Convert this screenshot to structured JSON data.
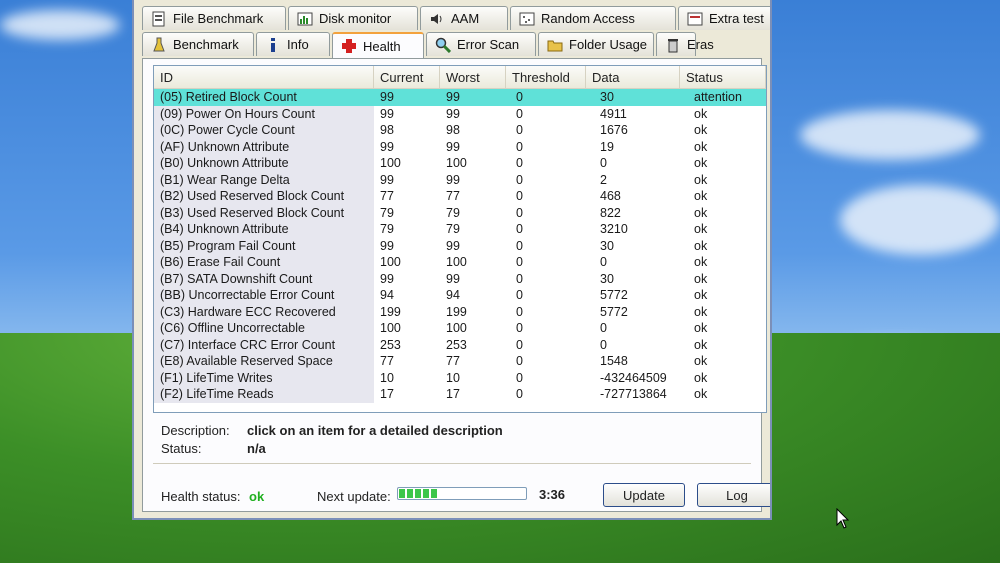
{
  "tabs_row1": [
    {
      "label": "File Benchmark",
      "icon": "file-benchmark-icon"
    },
    {
      "label": "Disk monitor",
      "icon": "disk-monitor-icon"
    },
    {
      "label": "AAM",
      "icon": "speaker-icon"
    },
    {
      "label": "Random Access",
      "icon": "random-access-icon"
    },
    {
      "label": "Extra test",
      "icon": "extra-tests-icon"
    }
  ],
  "tabs_row2": [
    {
      "label": "Benchmark",
      "icon": "benchmark-icon"
    },
    {
      "label": "Info",
      "icon": "info-icon"
    },
    {
      "label": "Health",
      "icon": "health-cross-icon",
      "active": true
    },
    {
      "label": "Error Scan",
      "icon": "magnifier-icon"
    },
    {
      "label": "Folder Usage",
      "icon": "folder-icon"
    },
    {
      "label": "Eras",
      "icon": "trash-icon"
    }
  ],
  "columns": [
    "ID",
    "Current",
    "Worst",
    "Threshold",
    "Data",
    "Status"
  ],
  "rows": [
    {
      "id": "(05) Retired Block Count",
      "cur": "99",
      "worst": "99",
      "thr": "0",
      "data": "30",
      "status": "attention"
    },
    {
      "id": "(09) Power On Hours Count",
      "cur": "99",
      "worst": "99",
      "thr": "0",
      "data": "4911",
      "status": "ok"
    },
    {
      "id": "(0C) Power Cycle Count",
      "cur": "98",
      "worst": "98",
      "thr": "0",
      "data": "1676",
      "status": "ok"
    },
    {
      "id": "(AF) Unknown Attribute",
      "cur": "99",
      "worst": "99",
      "thr": "0",
      "data": "19",
      "status": "ok"
    },
    {
      "id": "(B0) Unknown Attribute",
      "cur": "100",
      "worst": "100",
      "thr": "0",
      "data": "0",
      "status": "ok"
    },
    {
      "id": "(B1) Wear Range Delta",
      "cur": "99",
      "worst": "99",
      "thr": "0",
      "data": "2",
      "status": "ok"
    },
    {
      "id": "(B2) Used Reserved Block Count",
      "cur": "77",
      "worst": "77",
      "thr": "0",
      "data": "468",
      "status": "ok"
    },
    {
      "id": "(B3) Used Reserved Block Count",
      "cur": "79",
      "worst": "79",
      "thr": "0",
      "data": "822",
      "status": "ok"
    },
    {
      "id": "(B4) Unknown Attribute",
      "cur": "79",
      "worst": "79",
      "thr": "0",
      "data": "3210",
      "status": "ok"
    },
    {
      "id": "(B5) Program Fail Count",
      "cur": "99",
      "worst": "99",
      "thr": "0",
      "data": "30",
      "status": "ok"
    },
    {
      "id": "(B6) Erase Fail Count",
      "cur": "100",
      "worst": "100",
      "thr": "0",
      "data": "0",
      "status": "ok"
    },
    {
      "id": "(B7) SATA Downshift Count",
      "cur": "99",
      "worst": "99",
      "thr": "0",
      "data": "30",
      "status": "ok"
    },
    {
      "id": "(BB) Uncorrectable Error Count",
      "cur": "94",
      "worst": "94",
      "thr": "0",
      "data": "5772",
      "status": "ok"
    },
    {
      "id": "(C3) Hardware ECC Recovered",
      "cur": "199",
      "worst": "199",
      "thr": "0",
      "data": "5772",
      "status": "ok"
    },
    {
      "id": "(C6) Offline Uncorrectable",
      "cur": "100",
      "worst": "100",
      "thr": "0",
      "data": "0",
      "status": "ok"
    },
    {
      "id": "(C7) Interface CRC Error Count",
      "cur": "253",
      "worst": "253",
      "thr": "0",
      "data": "0",
      "status": "ok"
    },
    {
      "id": "(E8) Available Reserved Space",
      "cur": "77",
      "worst": "77",
      "thr": "0",
      "data": "1548",
      "status": "ok"
    },
    {
      "id": "(F1) LifeTime Writes",
      "cur": "10",
      "worst": "10",
      "thr": "0",
      "data": "-432464509",
      "status": "ok"
    },
    {
      "id": "(F2) LifeTime Reads",
      "cur": "17",
      "worst": "17",
      "thr": "0",
      "data": "-727713864",
      "status": "ok"
    }
  ],
  "description": {
    "label": "Description:",
    "value": "click on an item for a detailed description"
  },
  "status_line": {
    "label": "Status:",
    "value": "n/a"
  },
  "footer": {
    "health_label": "Health status:",
    "health_value": "ok",
    "next_update_label": "Next update:",
    "progress_fraction": 0.3,
    "time": "3:36",
    "update_button": "Update",
    "log_button": "Log"
  }
}
